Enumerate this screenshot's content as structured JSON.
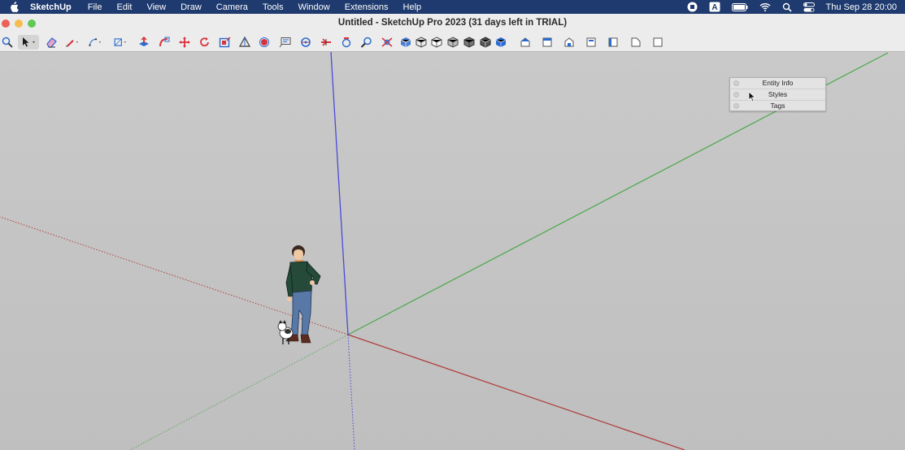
{
  "menubar": {
    "app_name": "SketchUp",
    "items": [
      "File",
      "Edit",
      "View",
      "Draw",
      "Camera",
      "Tools",
      "Window",
      "Extensions",
      "Help"
    ],
    "clock": "Thu Sep 28  20:00",
    "status_icons": [
      "screen-record-icon",
      "input-source-icon",
      "battery-icon",
      "wifi-icon",
      "spotlight-icon",
      "control-center-icon"
    ],
    "input_source_label": "A"
  },
  "window": {
    "title": "Untitled - SketchUp Pro 2023 (31 days left in TRIAL)"
  },
  "toolbar": {
    "tools": [
      "search",
      "select",
      "eraser",
      "line",
      "arc",
      "shape",
      "push-pull",
      "follow-me",
      "move",
      "rotate",
      "scale",
      "offset",
      "tape-measure",
      "protractor",
      "text",
      "dimension",
      "section-plane",
      "orbit",
      "zoom",
      "zoom-extents",
      "xray",
      "wireframe",
      "hidden-line",
      "shaded",
      "shaded-textures",
      "monochrome",
      "iso-view",
      "top-view",
      "front-view",
      "right-view",
      "back-view",
      "left-view",
      "bottom-view"
    ]
  },
  "tray": {
    "items": [
      {
        "label": "Entity Info"
      },
      {
        "label": "Styles"
      },
      {
        "label": "Tags"
      }
    ]
  },
  "colors": {
    "menubar_bg": "#1e3a6e",
    "red_axis": "#b03a3a",
    "green_axis": "#4aa84a",
    "blue_axis": "#4a4ad8"
  }
}
